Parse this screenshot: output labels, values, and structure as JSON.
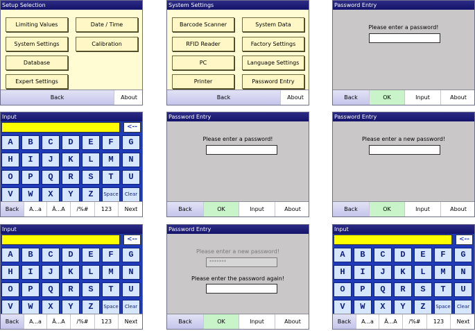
{
  "setup": {
    "title": "Setup Selection",
    "buttons": [
      "Limiting Values",
      "Date / Time",
      "System Settings",
      "Calibration",
      "Database",
      "Expert Settings"
    ],
    "bottom": [
      "Back",
      "About"
    ]
  },
  "system": {
    "title": "System Settings",
    "buttons": [
      "Barcode Scanner",
      "System Data",
      "RFID Reader",
      "Factory Settings",
      "PC",
      "Language Settings",
      "Printer",
      "Password Entry"
    ],
    "bottom": [
      "Back",
      "About"
    ]
  },
  "pw1": {
    "title": "Password Entry",
    "prompt": "Please enter a password!",
    "bottom": [
      "Back",
      "OK",
      "Input",
      "About"
    ]
  },
  "kb1": {
    "title": "Input",
    "backspace": "<--",
    "rows": [
      [
        "A",
        "B",
        "C",
        "D",
        "E",
        "F",
        "G"
      ],
      [
        "H",
        "I",
        "J",
        "K",
        "L",
        "M",
        "N"
      ],
      [
        "O",
        "P",
        "Q",
        "R",
        "S",
        "T",
        "U"
      ],
      [
        "V",
        "W",
        "X",
        "Y",
        "Z",
        "Space",
        "Clear"
      ]
    ],
    "bottom": [
      "Back",
      "A...a",
      "Ä...A",
      "/%#",
      "123",
      "Next"
    ]
  },
  "pw2": {
    "title": "Password Entry",
    "prompt": "Please enter a password!",
    "bottom": [
      "Back",
      "OK",
      "Input",
      "About"
    ]
  },
  "pw3": {
    "title": "Password Entry",
    "prompt": "Please enter a new password!",
    "bottom": [
      "Back",
      "OK",
      "Input",
      "About"
    ]
  },
  "kb2": {
    "title": "Input",
    "backspace": "<--",
    "rows": [
      [
        "A",
        "B",
        "C",
        "D",
        "E",
        "F",
        "G"
      ],
      [
        "H",
        "I",
        "J",
        "K",
        "L",
        "M",
        "N"
      ],
      [
        "O",
        "P",
        "Q",
        "R",
        "S",
        "T",
        "U"
      ],
      [
        "V",
        "W",
        "X",
        "Y",
        "Z",
        "Space",
        "Clear"
      ]
    ],
    "bottom": [
      "Back",
      "A...a",
      "Ä...A",
      "/%#",
      "123",
      "Next"
    ]
  },
  "pw4": {
    "title": "Password Entry",
    "prompt_dim": "Please enter a new password!",
    "masked_value": "*******",
    "prompt": "Please enter the password again!",
    "bottom": [
      "Back",
      "OK",
      "Input",
      "About"
    ]
  },
  "kb3": {
    "title": "Input",
    "backspace": "<--",
    "rows": [
      [
        "A",
        "B",
        "C",
        "D",
        "E",
        "F",
        "G"
      ],
      [
        "H",
        "I",
        "J",
        "K",
        "L",
        "M",
        "N"
      ],
      [
        "O",
        "P",
        "Q",
        "R",
        "S",
        "T",
        "U"
      ],
      [
        "V",
        "W",
        "X",
        "Y",
        "Z",
        "Space",
        "Clear"
      ]
    ],
    "bottom": [
      "Back",
      "A...a",
      "Ä...A",
      "/%#",
      "123",
      "Next"
    ]
  },
  "colors": {
    "titlebar": "#1a1a72",
    "menu_bg": "#fffbd2",
    "dialog_bg": "#c9c7c8",
    "keyboard_bg": "#1f3bb8",
    "input_field": "#ffff00",
    "ok_button": "#c9f4c9"
  }
}
